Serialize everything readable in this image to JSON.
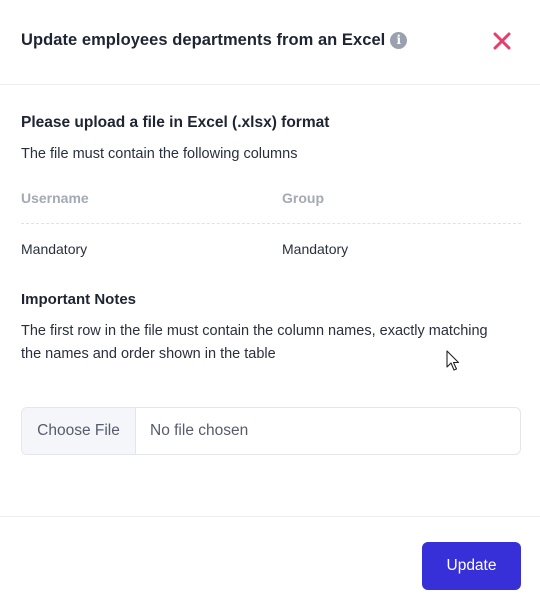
{
  "modal": {
    "title": "Update employees departments from an Excel",
    "info_icon": "info-icon",
    "close_icon": "close-icon",
    "close_color": "#e63d6b"
  },
  "upload": {
    "heading": "Please upload a file in Excel (.xlsx) format",
    "subtext": "The file must contain the following columns"
  },
  "columns_table": {
    "headers": [
      "Username",
      "Group"
    ],
    "rows": [
      [
        "Mandatory",
        "Mandatory"
      ]
    ]
  },
  "notes": {
    "heading": "Important Notes",
    "text": "The first row in the file must contain the column names, exactly matching the names and order shown in the table"
  },
  "file_input": {
    "button_label": "Choose File",
    "status": "No file chosen"
  },
  "footer": {
    "update_label": "Update",
    "accent_color": "#3730d8"
  }
}
